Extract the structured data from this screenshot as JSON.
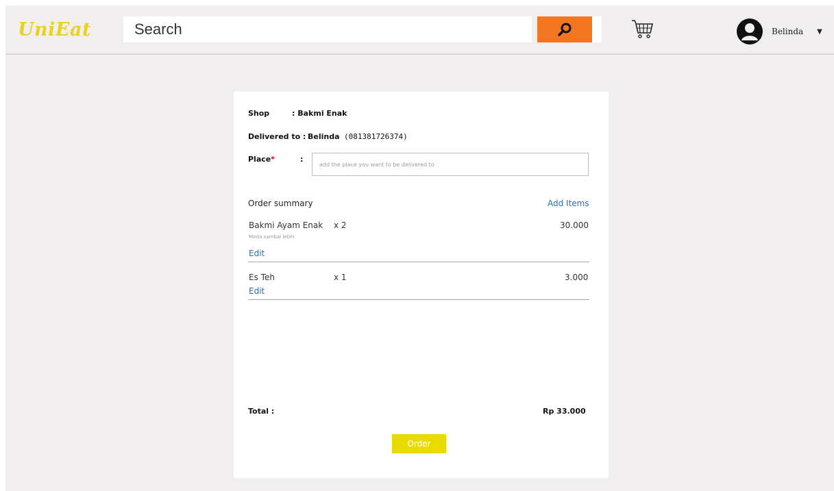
{
  "header": {
    "logo": "UniEat",
    "search_placeholder": "Search",
    "user_name": "Belinda",
    "colors": {
      "logo": "#e8d21c",
      "search_button": "#f47521"
    }
  },
  "order": {
    "shop_label": "Shop",
    "shop_value": ": Bakmi Enak",
    "delivered_label": "Delivered to :",
    "delivered_name": "Belinda",
    "delivered_phone": "(081381726374)",
    "place_label": "Place",
    "place_required_mark": "*",
    "place_colon": ":",
    "place_placeholder": "add the place you want to be delivered to",
    "summary_title": "Order summary",
    "add_items": "Add Items",
    "items": [
      {
        "name": "Bakmi Ayam Enak",
        "qty": "x 2",
        "price": "30.000",
        "note": "Minta sambal lebih",
        "edit": "Edit"
      },
      {
        "name": "Es Teh",
        "qty": "x 1",
        "price": "3.000",
        "note": "",
        "edit": "Edit"
      }
    ],
    "total_label": "Total :",
    "total_value": "Rp 33.000",
    "order_button": "Order",
    "colors": {
      "link": "#2e6cae",
      "order_button": "#e9db00",
      "required": "#d40000"
    }
  }
}
